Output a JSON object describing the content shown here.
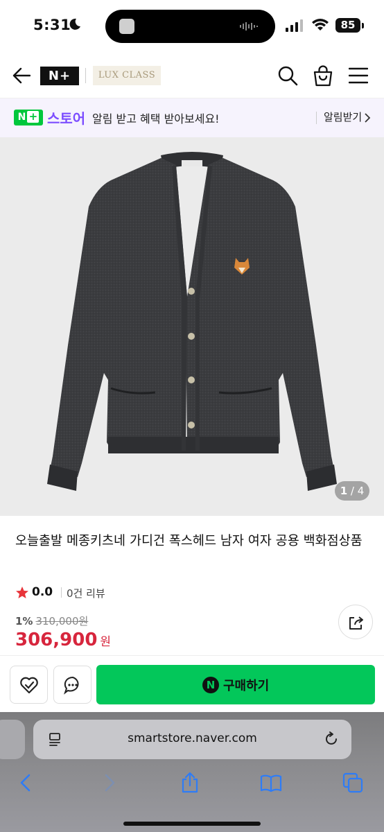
{
  "status_bar": {
    "time": "5:31",
    "battery": "85"
  },
  "header": {
    "logo": "N+",
    "badge": "LUX CLASS"
  },
  "store_banner": {
    "logo": "N",
    "logo_plus": "+",
    "store_name": "스토어",
    "message": "알림 받고 혜택 받아보세요!",
    "alarm_button": "알림받기"
  },
  "gallery": {
    "current": "1",
    "separator": "/",
    "total": "4"
  },
  "product": {
    "title": "오늘출발 메종키츠네 가디건 폭스헤드 남자 여자 공용 백화점상품",
    "rating": "0.0",
    "review_count": "0건 리뷰",
    "discount_rate": "1%",
    "original_price": "310,000원",
    "final_price": "306,900",
    "currency": "원"
  },
  "action_bar": {
    "buy_icon_letter": "N",
    "buy_label": "구매하기"
  },
  "safari": {
    "url": "smartstore.naver.com"
  },
  "colors": {
    "naver_green": "#03c75a",
    "store_purple": "#7c4dff",
    "price_red": "#d7263d",
    "star": "#e8343a"
  }
}
